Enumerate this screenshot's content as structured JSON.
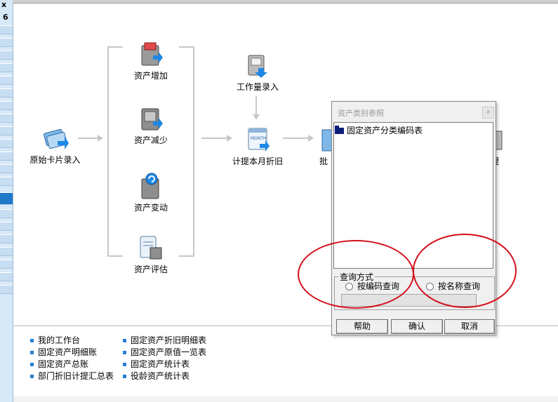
{
  "left_strip": {
    "top_glyph": "x",
    "badge": "6"
  },
  "flow": {
    "original_card_entry": "原始卡片录入",
    "asset_increase": "资产增加",
    "asset_decrease": "资产减少",
    "asset_change": "资产变动",
    "asset_evaluate": "资产评估",
    "workload_entry": "工作量录入",
    "depreciation": "计提本月折旧",
    "batch_partial": "批",
    "manage_partial": "理"
  },
  "links": [
    "我的工作台",
    "固定资产折旧明细表",
    "固定资产明细账",
    "固定资产原值一览表",
    "固定资产总账",
    "固定资产统计表",
    "部门折旧计提汇总表",
    "役龄资产统计表"
  ],
  "dialog": {
    "title": "资产类别参照",
    "close_glyph": "x",
    "tree_root": "固定资产分类编码表",
    "query_group_label": "查询方式",
    "radio_by_code": "按编码查询",
    "radio_by_name": "按名称查询",
    "query_value": "",
    "help_button": "帮助",
    "confirm_button": "确认",
    "cancel_button": "取消"
  },
  "colors": {
    "annotation": "#d4101a",
    "accent": "#1f78c8",
    "tree_folder": "#0b1f7a"
  }
}
